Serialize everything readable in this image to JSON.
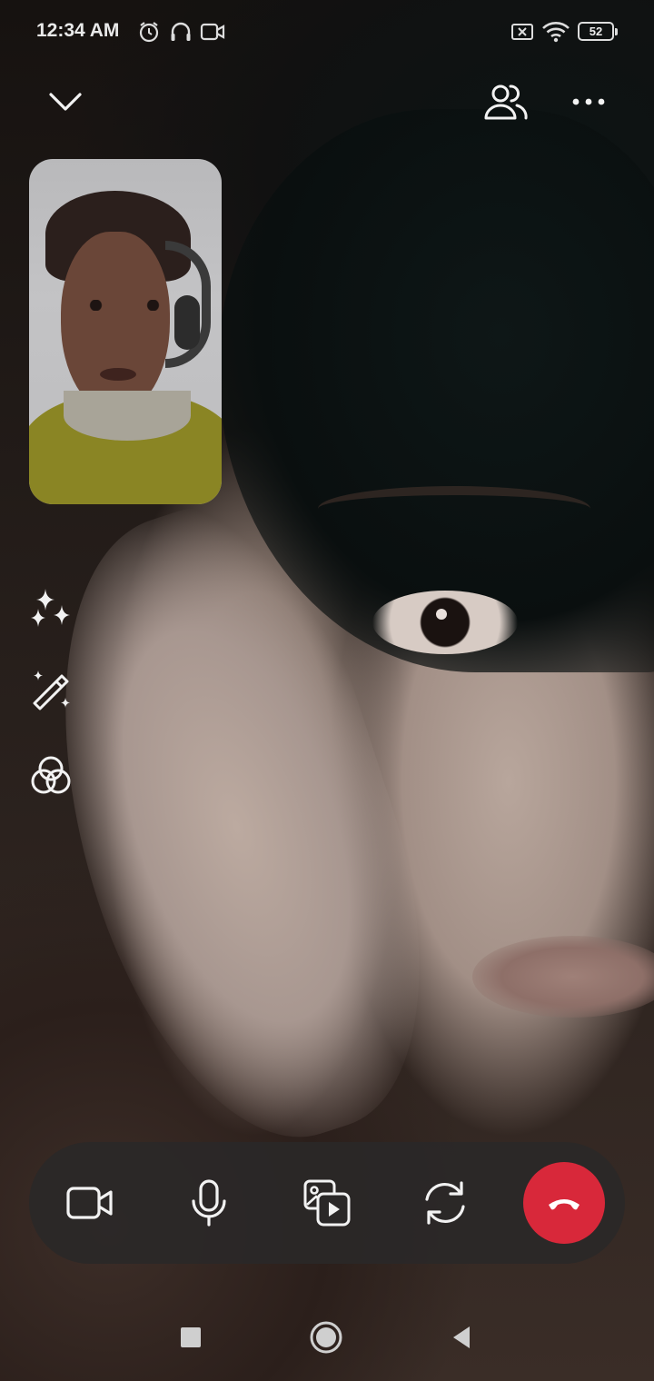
{
  "status_bar": {
    "time": "12:34 AM",
    "battery": "52",
    "icons": [
      "alarm-icon",
      "headphones-icon",
      "video-recording-icon",
      "sim-blocked-icon",
      "wifi-icon",
      "battery-icon"
    ]
  },
  "top_bar": {
    "icons": [
      "chevron-down-icon",
      "participants-icon",
      "more-options-icon"
    ]
  },
  "side_tools": {
    "icons": [
      "sparkles-effects-icon",
      "magic-wand-icon",
      "filters-icon"
    ]
  },
  "call_controls": {
    "icons": [
      "video-camera-icon",
      "microphone-icon",
      "media-share-icon",
      "switch-camera-icon",
      "end-call-icon"
    ],
    "end_call_color": "#d8283a"
  },
  "nav_bar": {
    "icons": [
      "recent-apps-icon",
      "home-icon",
      "back-icon"
    ]
  }
}
